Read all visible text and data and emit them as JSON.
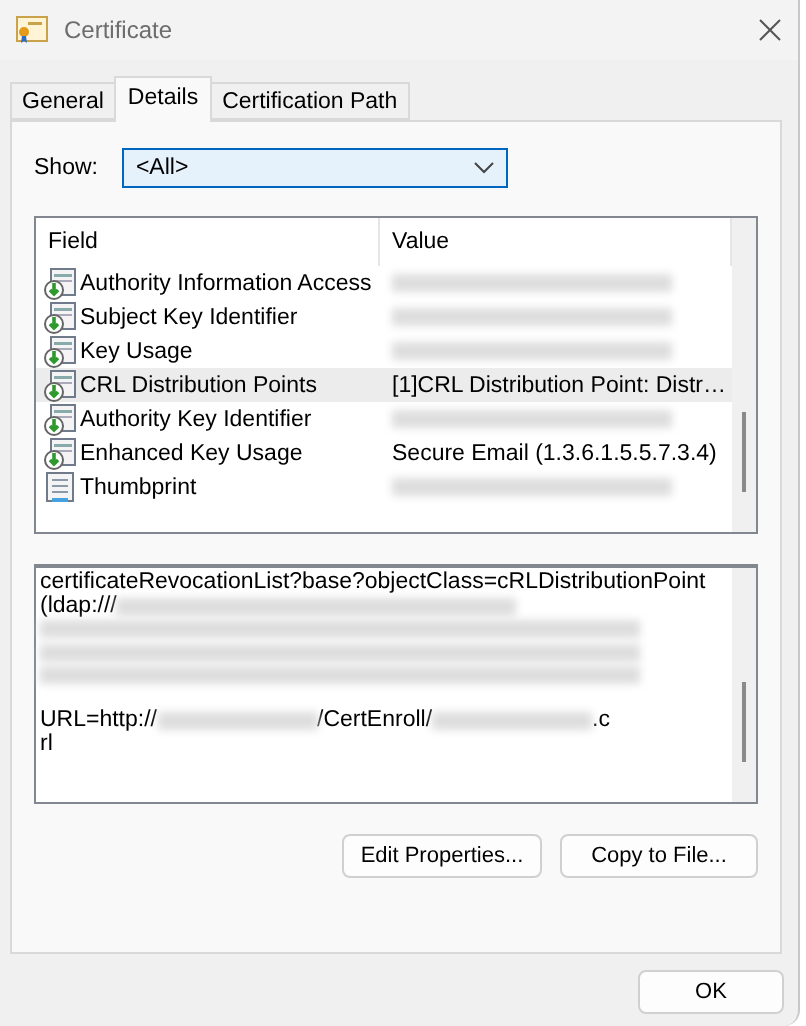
{
  "window": {
    "title": "Certificate"
  },
  "tabs": [
    {
      "label": "General",
      "selected": false
    },
    {
      "label": "Details",
      "selected": true
    },
    {
      "label": "Certification Path",
      "selected": false
    }
  ],
  "show": {
    "label": "Show:",
    "value": "<All>"
  },
  "table": {
    "columns": [
      "Field",
      "Value"
    ],
    "rows": [
      {
        "field": "Authority Information Access",
        "kind": "extension",
        "redacted": true,
        "selected": false
      },
      {
        "field": "Subject Key Identifier",
        "kind": "extension",
        "redacted": true,
        "selected": false
      },
      {
        "field": "Key Usage",
        "kind": "extension",
        "redacted": true,
        "selected": false
      },
      {
        "field": "CRL Distribution Points",
        "kind": "extension",
        "value": "[1]CRL Distribution Point: Distr…",
        "redacted": false,
        "selected": true
      },
      {
        "field": "Authority Key Identifier",
        "kind": "extension",
        "redacted": true,
        "selected": false
      },
      {
        "field": "Enhanced Key Usage",
        "kind": "extension",
        "value": "Secure Email (1.3.6.1.5.5.7.3.4)",
        "redacted": false,
        "selected": false
      },
      {
        "field": "Thumbprint",
        "kind": "property",
        "redacted": true,
        "selected": false
      }
    ]
  },
  "detail_lines": [
    [
      {
        "kind": "text",
        "text": "certificateRevocationList?base?objectClass=cRLDistributionPoint"
      }
    ],
    [
      {
        "kind": "text",
        "text": "(ldap:///"
      },
      {
        "kind": "redacted"
      }
    ],
    [
      {
        "kind": "redacted"
      }
    ],
    [
      {
        "kind": "redacted"
      }
    ],
    [
      {
        "kind": "redacted"
      }
    ],
    [
      {
        "kind": "blank"
      }
    ],
    [
      {
        "kind": "text",
        "text": "URL=http://"
      },
      {
        "kind": "redacted"
      },
      {
        "kind": "text",
        "text": "/CertEnroll/"
      },
      {
        "kind": "redacted"
      },
      {
        "kind": "text",
        "text": ".c"
      }
    ],
    [
      {
        "kind": "text",
        "text": "rl"
      }
    ]
  ],
  "buttons": [
    "Edit Properties...",
    "Copy to File..."
  ],
  "footer_buttons": [
    "OK"
  ]
}
